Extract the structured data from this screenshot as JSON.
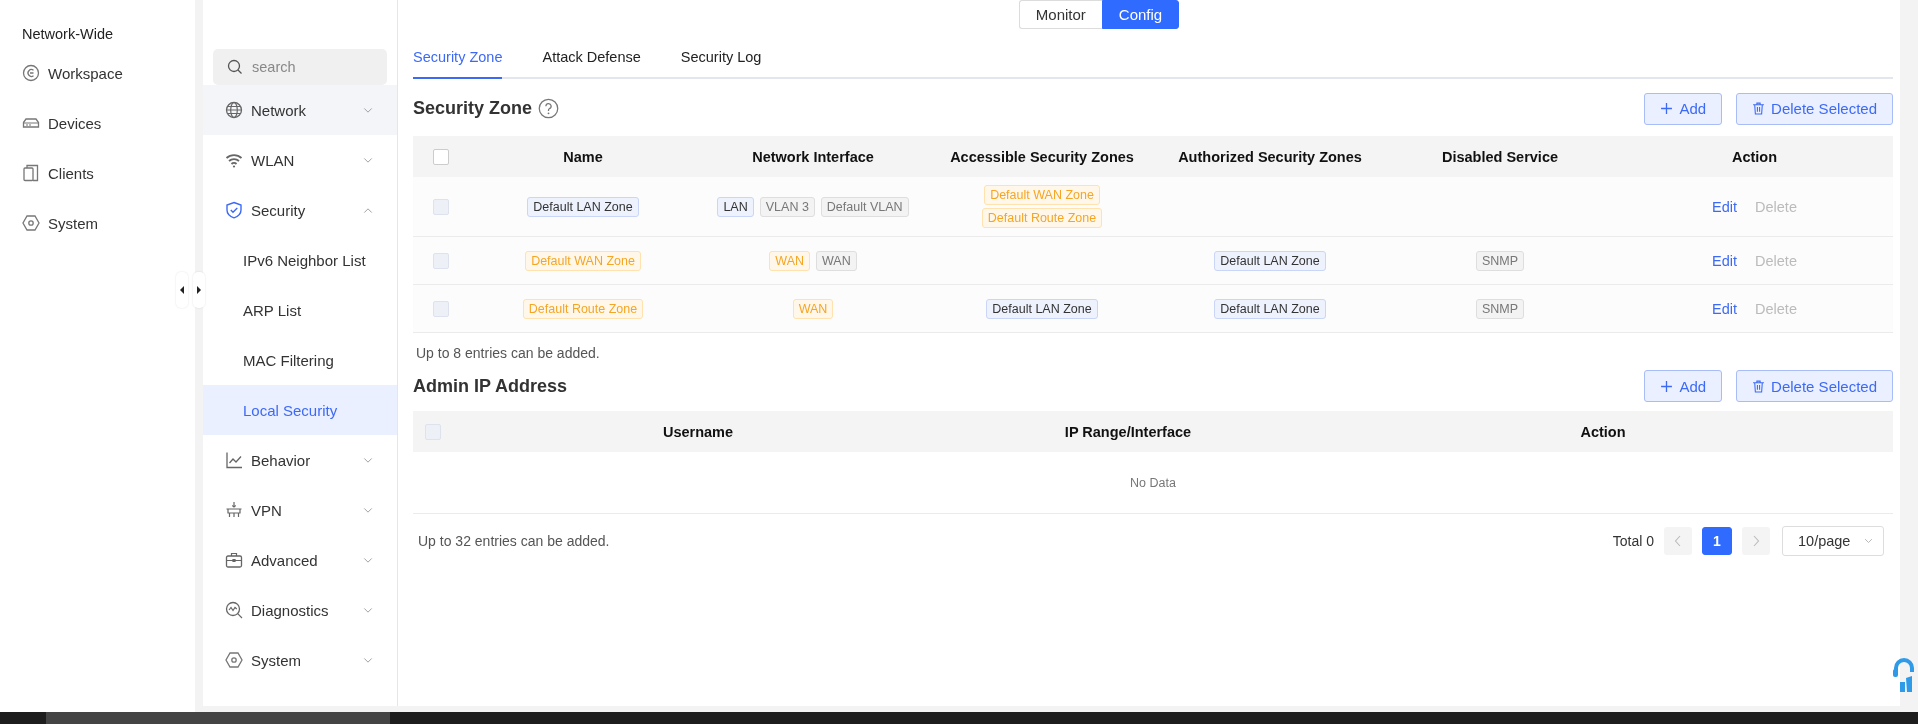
{
  "nav": {
    "title": "Network-Wide",
    "items": [
      {
        "label": "Workspace"
      },
      {
        "label": "Devices"
      },
      {
        "label": "Clients"
      },
      {
        "label": "System"
      }
    ]
  },
  "mode_switch": [
    {
      "label": "Monitor",
      "selected": false
    },
    {
      "label": "Config",
      "selected": true
    }
  ],
  "menu": {
    "search": {
      "placeholder": "search"
    },
    "items": [
      {
        "label": "Network",
        "expanded": false,
        "hovered": true
      },
      {
        "label": "WLAN",
        "expanded": false,
        "hovered": false
      },
      {
        "label": "Security",
        "expanded": true,
        "hovered": false,
        "children": [
          {
            "label": "IPv6 Neighbor List",
            "selected": false
          },
          {
            "label": "ARP List",
            "selected": false
          },
          {
            "label": "MAC Filtering",
            "selected": false
          },
          {
            "label": "Local Security",
            "selected": true
          }
        ]
      },
      {
        "label": "Behavior",
        "expanded": false,
        "hovered": false
      },
      {
        "label": "VPN",
        "expanded": false,
        "hovered": false
      },
      {
        "label": "Advanced",
        "expanded": false,
        "hovered": false
      },
      {
        "label": "Diagnostics",
        "expanded": false,
        "hovered": false
      },
      {
        "label": "System",
        "expanded": false,
        "hovered": false
      }
    ]
  },
  "tabs": [
    {
      "label": "Security Zone",
      "selected": true
    },
    {
      "label": "Attack Defense",
      "selected": false
    },
    {
      "label": "Security Log",
      "selected": false
    }
  ],
  "security_zone": {
    "title": "Security Zone",
    "buttons": [
      {
        "kind": "add",
        "label": "Add"
      },
      {
        "kind": "delete",
        "label": "Delete Selected"
      }
    ],
    "columns": [
      "Name",
      "Network Interface",
      "Accessible Security Zones",
      "Authorized Security Zones",
      "Disabled Service",
      "Action"
    ],
    "header_checkbox": {
      "checked": false,
      "disabled": false
    },
    "rows": [
      {
        "checkbox": {
          "checked": false,
          "disabled": true
        },
        "name": {
          "label": "Default LAN Zone",
          "kind": "primary"
        },
        "interfaces": [
          {
            "label": "LAN",
            "kind": "primary"
          },
          {
            "label": "VLAN 3",
            "kind": "neutral"
          },
          {
            "label": "Default VLAN",
            "kind": "neutral"
          }
        ],
        "accessible": [
          {
            "label": "Default WAN Zone",
            "kind": "warning"
          },
          {
            "label": "Default Route Zone",
            "kind": "warning"
          }
        ],
        "authorized": [],
        "disabled_services": [],
        "actions": [
          {
            "label": "Edit",
            "disabled": false
          },
          {
            "label": "Delete",
            "disabled": true
          }
        ]
      },
      {
        "checkbox": {
          "checked": false,
          "disabled": true
        },
        "name": {
          "label": "Default WAN Zone",
          "kind": "warning"
        },
        "interfaces": [
          {
            "label": "WAN",
            "kind": "warning"
          },
          {
            "label": "WAN",
            "kind": "neutral"
          }
        ],
        "accessible": [],
        "authorized": [
          {
            "label": "Default LAN Zone",
            "kind": "primary"
          }
        ],
        "disabled_services": [
          {
            "label": "SNMP",
            "kind": "neutral"
          }
        ],
        "actions": [
          {
            "label": "Edit",
            "disabled": false
          },
          {
            "label": "Delete",
            "disabled": true
          }
        ]
      },
      {
        "checkbox": {
          "checked": false,
          "disabled": true
        },
        "name": {
          "label": "Default Route Zone",
          "kind": "warning"
        },
        "interfaces": [
          {
            "label": "WAN",
            "kind": "warning"
          }
        ],
        "accessible": [
          {
            "label": "Default LAN Zone",
            "kind": "primary"
          }
        ],
        "authorized": [
          {
            "label": "Default LAN Zone",
            "kind": "primary"
          }
        ],
        "disabled_services": [
          {
            "label": "SNMP",
            "kind": "neutral"
          }
        ],
        "actions": [
          {
            "label": "Edit",
            "disabled": false
          },
          {
            "label": "Delete",
            "disabled": true
          }
        ]
      }
    ],
    "note": "Up to 8 entries can be added."
  },
  "admin_ip": {
    "title": "Admin IP Address",
    "buttons": [
      {
        "kind": "add",
        "label": "Add"
      },
      {
        "kind": "delete",
        "label": "Delete Selected"
      }
    ],
    "columns": [
      "Username",
      "IP Range/Interface",
      "Action"
    ],
    "header_checkbox": {
      "checked": false,
      "disabled": true
    },
    "empty_text": "No Data",
    "note": "Up to 32 entries can be added.",
    "pagination": {
      "total": "Total 0",
      "prev_disabled": true,
      "pages": [
        {
          "label": "1",
          "selected": true
        }
      ],
      "next_disabled": true,
      "page_size": "10/page"
    }
  }
}
